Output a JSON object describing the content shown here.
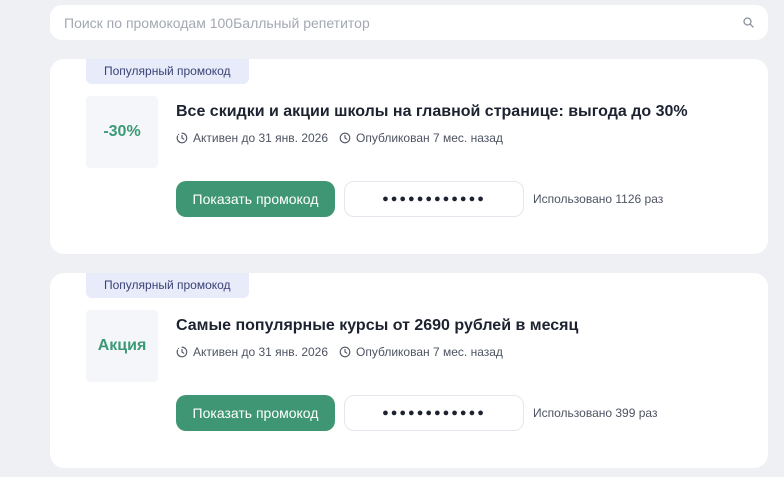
{
  "search": {
    "placeholder": "Поиск по промокодам 100Балльный репетитор"
  },
  "offers": [
    {
      "badge": "Популярный промокод",
      "discount": "-30%",
      "title": "Все скидки и акции школы на главной странице: выгода до 30%",
      "active_until": "Активен до 31 янв. 2026",
      "published": "Опубликован 7 мес. назад",
      "button_label": "Показать промокод",
      "masked_code": "●●●●●●●●●●●●",
      "usage": "Использовано 1126 раз"
    },
    {
      "badge": "Популярный промокод",
      "discount": "Акция",
      "title": "Самые популярные курсы от 2690 рублей в месяц",
      "active_until": "Активен до 31 янв. 2026",
      "published": "Опубликован 7 мес. назад",
      "button_label": "Показать промокод",
      "masked_code": "●●●●●●●●●●●●",
      "usage": "Использовано 399 раз"
    }
  ],
  "colors": {
    "accent": "#3f9675",
    "discount_text": "#3b9a75",
    "badge_bg": "#e7ebfa",
    "page_bg": "#eef0f4"
  },
  "icons": {
    "search": "search-icon",
    "active": "clock-timer-icon",
    "published": "clock-icon"
  }
}
